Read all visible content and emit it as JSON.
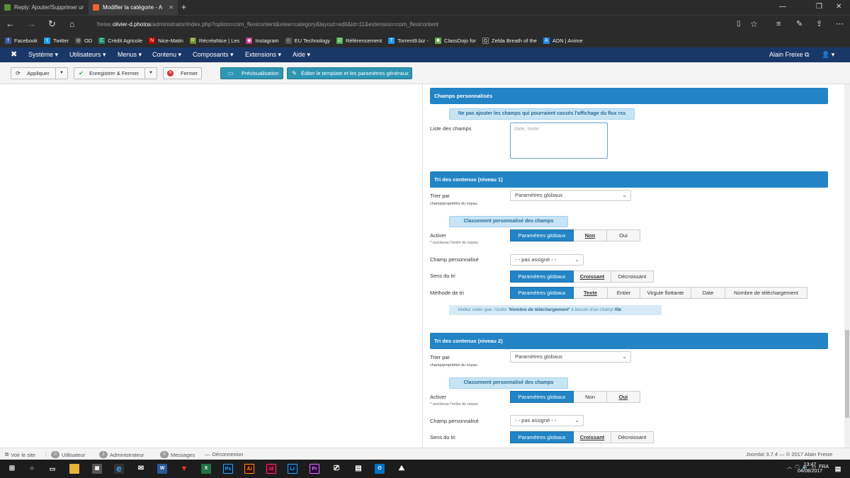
{
  "browser": {
    "tabs": [
      {
        "title": "Reply: Ajouter/Supprimer ur",
        "active": false
      },
      {
        "title": "Modifier la catégorie - A",
        "active": true
      }
    ],
    "new_tab": "+",
    "url_prefix": "freixe.",
    "url_domain": "olivier-d.photos",
    "url_path": "/administrator/index.php?option=com_flexicontent&view=category&layout=edit&id=11&extension=com_flexicontent",
    "favorites": [
      {
        "label": "Facebook",
        "color": "#3b5998",
        "icon": "f"
      },
      {
        "label": "Twitter",
        "color": "#1da1f2",
        "icon": "t"
      },
      {
        "label": "OD",
        "color": "#444444",
        "icon": "◎"
      },
      {
        "label": "Crédit Agricole",
        "color": "#1a8a6b",
        "icon": "C"
      },
      {
        "label": "Nice-Matin",
        "color": "#c00000",
        "icon": "N"
      },
      {
        "label": "RécréaNice | Les",
        "color": "#6b8e23",
        "icon": "R"
      },
      {
        "label": "Instagram",
        "color": "#c13584",
        "icon": "◉"
      },
      {
        "label": "EU Technology",
        "color": "#555555",
        "icon": "○"
      },
      {
        "label": "Référencement",
        "color": "#4caf50",
        "icon": "☑"
      },
      {
        "label": "Torrent9.biz -",
        "color": "#2196f3",
        "icon": "T"
      },
      {
        "label": "ClassDojo for",
        "color": "#6aa84f",
        "icon": "☻"
      },
      {
        "label": "Zelda Breath of the",
        "color": "#222222",
        "icon": "G"
      },
      {
        "label": "ADN | Anime",
        "color": "#1e88e5",
        "icon": "A"
      }
    ]
  },
  "joomla_nav": {
    "menus": [
      "Système",
      "Utilisateurs",
      "Menus",
      "Contenu",
      "Composants",
      "Extensions",
      "Aide"
    ],
    "user": "Alain Freixe"
  },
  "toolbar": {
    "apply": "Appliquer",
    "save_close": "Enregistrer & Fermer",
    "close": "Fermer",
    "preview": "Prévisualisation",
    "edit_template": "Éditer le template et les paramètres généraux"
  },
  "form": {
    "custom_fields": {
      "heading": "Champs personnalisés",
      "info": "Ne pas ajouter les champs qui pourraient cassés l'affichage du flux rss",
      "list_label": "Liste des champs",
      "list_placeholder": "date, texte"
    },
    "sort1": {
      "heading": "Tri des contenus (niveau 1)",
      "sort_by_label": "Trier par",
      "sort_by_sub": "champ/propriétés du noyau",
      "sort_by_value": "Paramètres globaux",
      "custom_sort_info": "Classement personnalisé des champs",
      "activate_label": "Activer",
      "activate_sub": "* surclasse l'ordre du noyau",
      "activate_options": [
        "Paramètres globaux",
        "Non",
        "Oui"
      ],
      "custom_field_label": "Champ personnalisé",
      "custom_field_value": "- - pas assigné - -",
      "direction_label": "Sens du tri",
      "direction_options": [
        "Paramètres globaux",
        "Croissant",
        "Décroissant"
      ],
      "method_label": "Méthode de tri",
      "method_options": [
        "Paramètres globaux",
        "Texte",
        "Entier",
        "Virgule flottante",
        "Date",
        "Nombre de téléchargement"
      ],
      "note_pre": "Veillez noter que: l'ordre ",
      "note_bold": "'Nombre de téléchargement'",
      "note_mid": " à besoin d'un champ ",
      "note_field": "file"
    },
    "sort2": {
      "heading": "Tri des contenus (niveau 2)",
      "sort_by_label": "Trier par",
      "sort_by_sub": "champ/propriétés du noyau",
      "sort_by_value": "Paramètres globaux",
      "custom_sort_info": "Classement personnalisé des champs",
      "activate_label": "Activer",
      "activate_sub": "* surclasse l'ordre du noyau",
      "activate_options": [
        "Paramètres globaux",
        "Non",
        "Oui"
      ],
      "custom_field_label": "Champ personnalisé",
      "custom_field_value": "- - pas assigné - -",
      "direction_label": "Sens du tri",
      "direction_options": [
        "Paramètres globaux",
        "Croissant",
        "Décroissant"
      ]
    }
  },
  "status": {
    "view_site": "Voir le site",
    "users_count": "0",
    "users_label": "Utilisateur",
    "admins_count": "1",
    "admins_label": "Administrateur",
    "messages_count": "0",
    "messages_label": "Messages",
    "logout": "Déconnexion",
    "version": "Joomla! 3.7.4",
    "copyright": "— © 2017 Alain Freixe"
  },
  "taskbar": {
    "lang": "FRA",
    "time": "13:47",
    "date": "04/08/2017"
  },
  "colors": {
    "nav_bg": "#1a3867",
    "accent": "#2284c5",
    "info_bg": "#c7e4f5"
  }
}
